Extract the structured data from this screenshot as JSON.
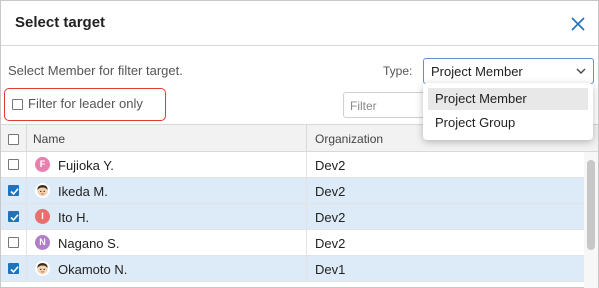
{
  "dialog": {
    "title": "Select target",
    "instruction": "Select Member for filter target.",
    "type_label": "Type:",
    "type_value": "Project Member",
    "leader_label": "Filter for leader only",
    "filter_placeholder": "Filter"
  },
  "dropdown": {
    "options": [
      "Project Member",
      "Project Group"
    ],
    "highlighted": "Project Member"
  },
  "grid": {
    "columns": {
      "name": "Name",
      "organization": "Organization"
    },
    "rows": [
      {
        "name": "Fujioka Y.",
        "organization": "Dev2",
        "checked": false,
        "avatar_letter": "F",
        "avatar_color": "#e97fb0"
      },
      {
        "name": "Ikeda M.",
        "organization": "Dev2",
        "checked": true,
        "avatar_letter": "",
        "avatar_icon": "person-avatar-icon"
      },
      {
        "name": "Ito H.",
        "organization": "Dev2",
        "checked": true,
        "avatar_letter": "I",
        "avatar_color": "#e86f6f"
      },
      {
        "name": "Nagano S.",
        "organization": "Dev2",
        "checked": false,
        "avatar_letter": "N",
        "avatar_color": "#b07fc8"
      },
      {
        "name": "Okamoto N.",
        "organization": "Dev1",
        "checked": true,
        "avatar_letter": "",
        "avatar_icon": "person-avatar-icon"
      }
    ]
  },
  "colors": {
    "selected_row": "#dcebf7",
    "checkbox_checked": "#1e73be",
    "highlight_border": "#e53935",
    "close_icon": "#1e73be"
  }
}
